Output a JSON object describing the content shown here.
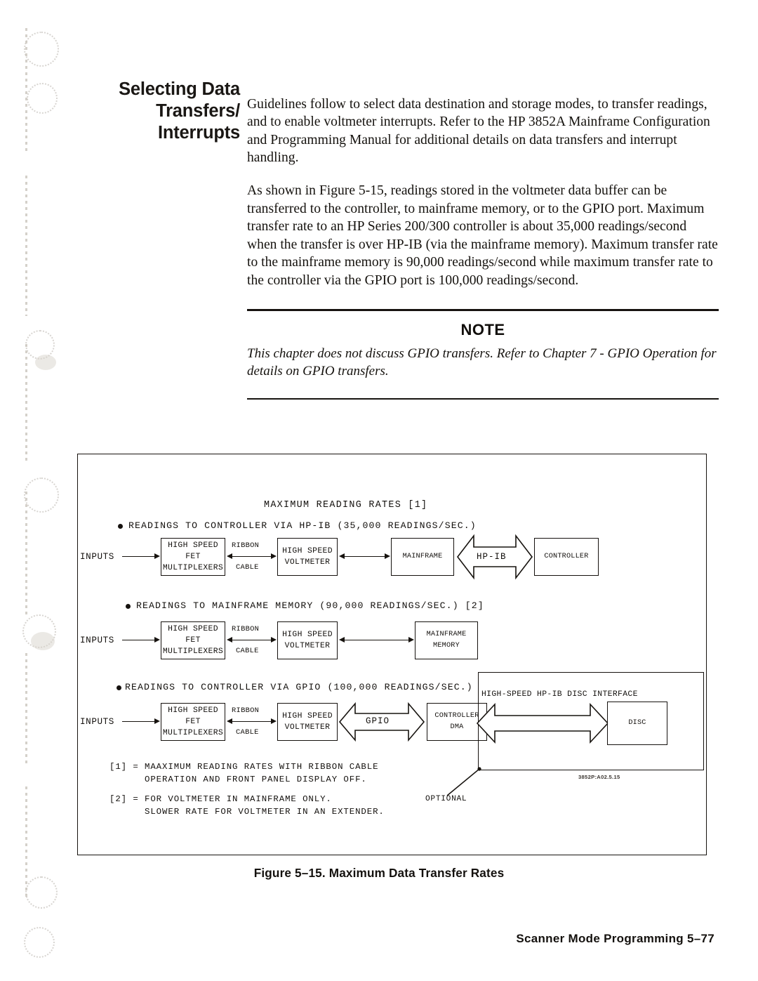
{
  "section": {
    "heading_lines": [
      "Selecting Data",
      "Transfers/",
      "Interrupts"
    ]
  },
  "body": {
    "paragraph_1": "Guidelines follow to select data destination and storage modes, to transfer readings, and to enable voltmeter interrupts. Refer to the HP 3852A Mainframe Configuration and Programming Manual for additional details on data transfers and interrupt handling.",
    "paragraph_2": "As shown in Figure 5-15, readings stored in the voltmeter data buffer can be transferred to the controller, to mainframe memory, or to the GPIO port. Maximum transfer rate to an HP Series 200/300 controller is about 35,000 readings/second when the transfer is over HP-IB (via the mainframe memory). Maximum transfer rate to the mainframe memory is 90,000 readings/second while maximum transfer rate to the controller via the GPIO port is 100,000 readings/second."
  },
  "note": {
    "title": "NOTE",
    "text": "This chapter does not discuss GPIO transfers.  Refer to Chapter 7 - GPIO Operation for details on GPIO transfers."
  },
  "figure": {
    "diagram_title": "MAXIMUM READING RATES [1]",
    "rows": [
      {
        "bullet_text": "READINGS TO CONTROLLER VIA HP-IB (35,000 READINGS/SEC.)",
        "inputs_label": "INPUTS",
        "mux_lines": [
          "HIGH SPEED",
          "FET",
          "MULTIPLEXERS"
        ],
        "cable_top": "RIBBON",
        "cable_bottom": "CABLE",
        "voltmeter_lines": [
          "HIGH SPEED",
          "VOLTMETER"
        ],
        "dest_lines": [
          "MAINFRAME"
        ],
        "bus_label": "HP-IB",
        "end_lines": [
          "CONTROLLER"
        ]
      },
      {
        "bullet_text": "READINGS TO MAINFRAME MEMORY (90,000 READINGS/SEC.) [2]",
        "inputs_label": "INPUTS",
        "mux_lines": [
          "HIGH SPEED",
          "FET",
          "MULTIPLEXERS"
        ],
        "cable_top": "RIBBON",
        "cable_bottom": "CABLE",
        "voltmeter_lines": [
          "HIGH SPEED",
          "VOLTMETER"
        ],
        "dest_lines": [
          "MAINFRAME",
          "MEMORY"
        ]
      },
      {
        "bullet_text": "READINGS TO CONTROLLER VIA GPIO (100,000 READINGS/SEC.)",
        "inputs_label": "INPUTS",
        "mux_lines": [
          "HIGH SPEED",
          "FET",
          "MULTIPLEXERS"
        ],
        "cable_top": "RIBBON",
        "cable_bottom": "CABLE",
        "voltmeter_lines": [
          "HIGH SPEED",
          "VOLTMETER"
        ],
        "bus_label": "GPIO",
        "dma_lines": [
          "CONTROLLER",
          "DMA"
        ],
        "disc_interface_label": "HIGH-SPEED HP-IB DISC INTERFACE",
        "disc_lines": [
          "DISC"
        ],
        "optional_label": "OPTIONAL"
      }
    ],
    "footnotes": [
      "[1] = MAAXIMUM READING RATES WITH RIBBON CABLE\n      OPERATION AND FRONT PANEL DISPLAY OFF.",
      "[2] = FOR VOLTMETER IN MAINFRAME ONLY.\n      SLOWER RATE FOR VOLTMETER IN AN EXTENDER."
    ],
    "drawing_code": "3852P:A02.5.15",
    "caption": "Figure 5–15. Maximum Data Transfer Rates"
  },
  "footer": {
    "text": "Scanner Mode Programming   5–77"
  }
}
